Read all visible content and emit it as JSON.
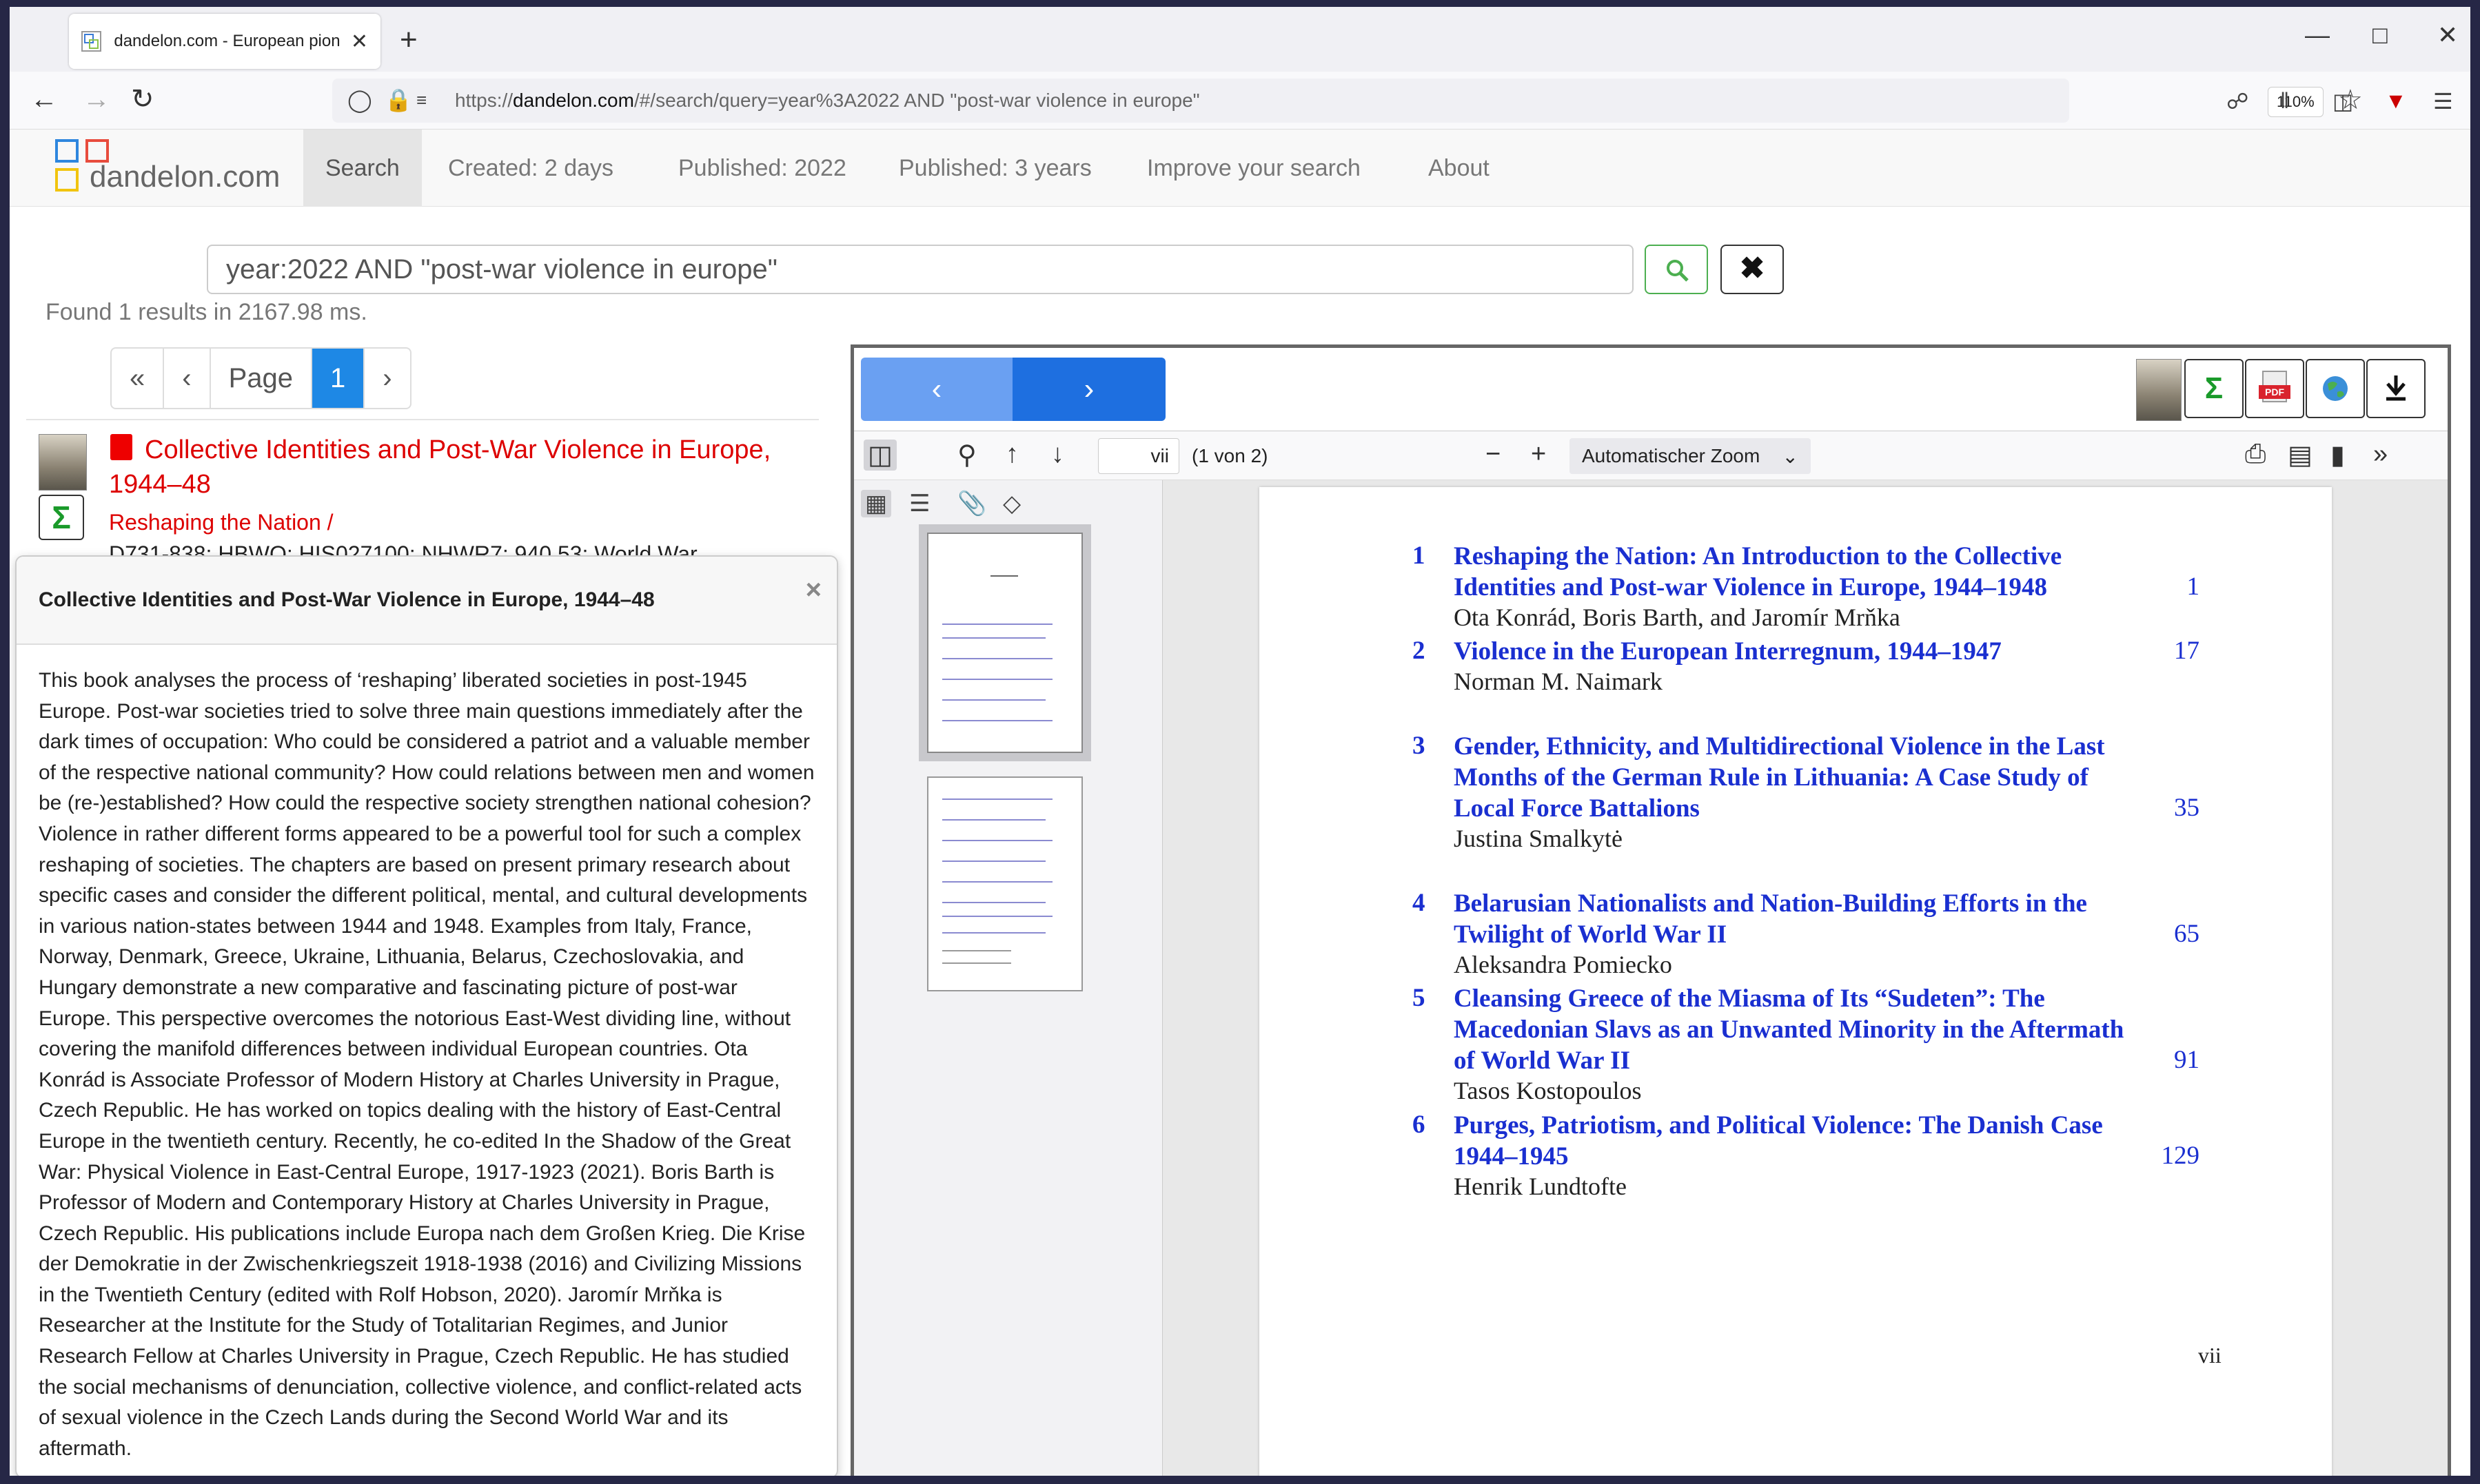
{
  "browser": {
    "tab_title": "dandelon.com - European pion",
    "tab_close": "✕",
    "new_tab": "+",
    "url_scheme": "https://",
    "url_host": "dandelon.com",
    "url_path": "/#/search/query=year%3A2022 AND \"post-war violence in europe\"",
    "zoom": "110%",
    "icons": [
      "back-icon",
      "forward-icon",
      "reload-icon",
      "shield-icon",
      "lock-icon",
      "star-icon",
      "pocket-icon",
      "library-icon",
      "sidebar-icon",
      "extension-icon",
      "menu-icon"
    ]
  },
  "site": {
    "logo_text": "dandelon.com",
    "nav": [
      "Search",
      "Created: 2 days",
      "Published: 2022",
      "Published: 3 years",
      "Improve your search",
      "About"
    ],
    "search_value": "year:2022 AND \"post-war violence in europe\"",
    "clear_label": "✖",
    "found": "Found 1 results in 2167.98 ms.",
    "pager": [
      "«",
      "‹",
      "Page",
      "1",
      "›"
    ]
  },
  "result": {
    "title": "Collective Identities and Post-War Violence in Europe, 1944–48",
    "series": "Reshaping the Nation /",
    "classification": "D731-838; HBWQ; HIS027100; NHWR7; 940.53; World War,",
    "sigma": "Σ"
  },
  "popover": {
    "title": "Collective Identities and Post-War Violence in Europe, 1944–48",
    "close": "×",
    "body": "This book analyses the process of ‘reshaping’ liberated societies in post-1945 Europe. Post-war societies tried to solve three main questions immediately after the dark times of occupation: Who could be considered a patriot and a valuable member of the respective national community? How could relations between men and women be (re-)established? How could the respective society strengthen national cohesion? Violence in rather different forms appeared to be a powerful tool for such a complex reshaping of societies. The chapters are based on present primary research about specific cases and consider the different political, mental, and cultural developments in various nation-states between 1944 and 1948. Examples from Italy, France, Norway, Denmark, Greece, Ukraine, Lithuania, Belarus, Czechoslovakia, and Hungary demonstrate a new comparative and fascinating picture of post-war Europe. This perspective overcomes the notorious East-West dividing line, without covering the manifold differences between individual European countries. Ota Konrád is Associate Professor of Modern History at Charles University in Prague, Czech Republic. He has worked on topics dealing with the history of East-Central Europe in the twentieth century. Recently, he co-edited In the Shadow of the Great War: Physical Violence in East-Central Europe, 1917-1923 (2021). Boris Barth is Professor of Modern and Contemporary History at Charles University in Prague, Czech Republic. His publications include Europa nach dem Großen Krieg. Die Krise der Demokratie in der Zwischenkriegszeit 1918-1938 (2016) and Civilizing Missions in the Twentieth Century (edited with Rolf Hobson, 2020). Jaromír Mrňka is Researcher at the Institute for the Study of Totalitarian Regimes, and Junior Research Fellow at Charles University in Prague, Czech Republic. He has studied the social mechanisms of denunciation, collective violence, and conflict-related acts of sexual violence in the Czech Lands during the Second World War and its aftermath."
  },
  "viewer": {
    "prev": "‹",
    "next": "›",
    "sigma": "Σ",
    "pdf_label": "PDF",
    "page_input": "vii",
    "page_of": "(1 von 2)",
    "zoom": "Automatischer Zoom",
    "zoom_minus": "−",
    "zoom_plus": "+",
    "page_footer": "vii"
  },
  "toc": [
    {
      "num": "1",
      "title": "Reshaping the Nation: An Introduction to the Collective Identities and Post-war Violence in Europe, 1944–1948",
      "author": "Ota Konrád, Boris Barth, and Jaromír Mrňka",
      "page": "1"
    },
    {
      "num": "2",
      "title": "Violence in the European Interregnum, 1944–1947",
      "author": "Norman M. Naimark",
      "page": "17"
    },
    {
      "num": "3",
      "title": "Gender, Ethnicity, and Multidirectional Violence in the Last Months of the German Rule in Lithuania: A Case Study of Local Force Battalions",
      "author": "Justina Smalkytė",
      "page": "35"
    },
    {
      "num": "4",
      "title": "Belarusian Nationalists and Nation-Building Efforts in the Twilight of World War II",
      "author": "Aleksandra Pomiecko",
      "page": "65"
    },
    {
      "num": "5",
      "title": "Cleansing Greece of the Miasma of Its “Sudeten”: The Macedonian Slavs as an Unwanted Minority in the Aftermath of World War II",
      "author": "Tasos Kostopoulos",
      "page": "91"
    },
    {
      "num": "6",
      "title": "Purges, Patriotism, and Political Violence: The Danish Case 1944–1945",
      "author": "Henrik Lundtofte",
      "page": "129"
    }
  ]
}
